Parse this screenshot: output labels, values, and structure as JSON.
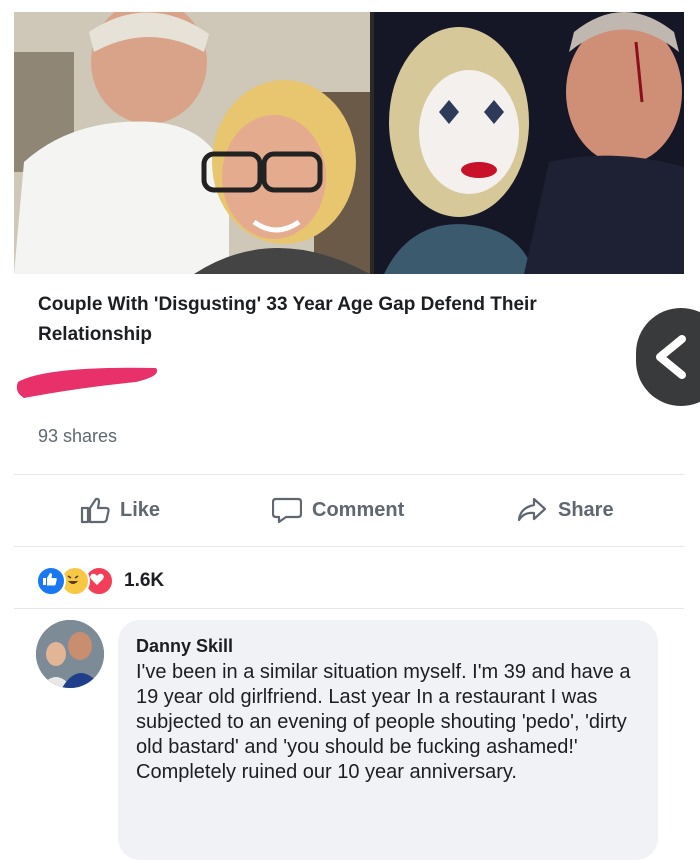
{
  "link_post": {
    "title": "Couple With 'Disgusting' 33 Year Age Gap Defend Their Relationship",
    "shares": "93 shares"
  },
  "actions": {
    "like": "Like",
    "comment": "Comment",
    "share": "Share"
  },
  "reactions": {
    "icons": [
      "like-icon",
      "haha-icon",
      "love-icon"
    ],
    "count": "1.6K"
  },
  "comment": {
    "author": "Danny Skill",
    "text": "I've been in a similar situation myself. I'm 39 and have a 19 year old girlfriend. Last year In a restaurant I was subjected to an evening of people shouting 'pedo', 'dirty old bastard' and 'you should be fucking ashamed!'",
    "text_line2": "Completely ruined our 10 year anniversary."
  },
  "colors": {
    "redaction": "#e8306a",
    "like_blue": "#1877f2",
    "haha_yellow": "#f7c843",
    "love_red": "#f33e58",
    "muted_text": "#606770"
  }
}
